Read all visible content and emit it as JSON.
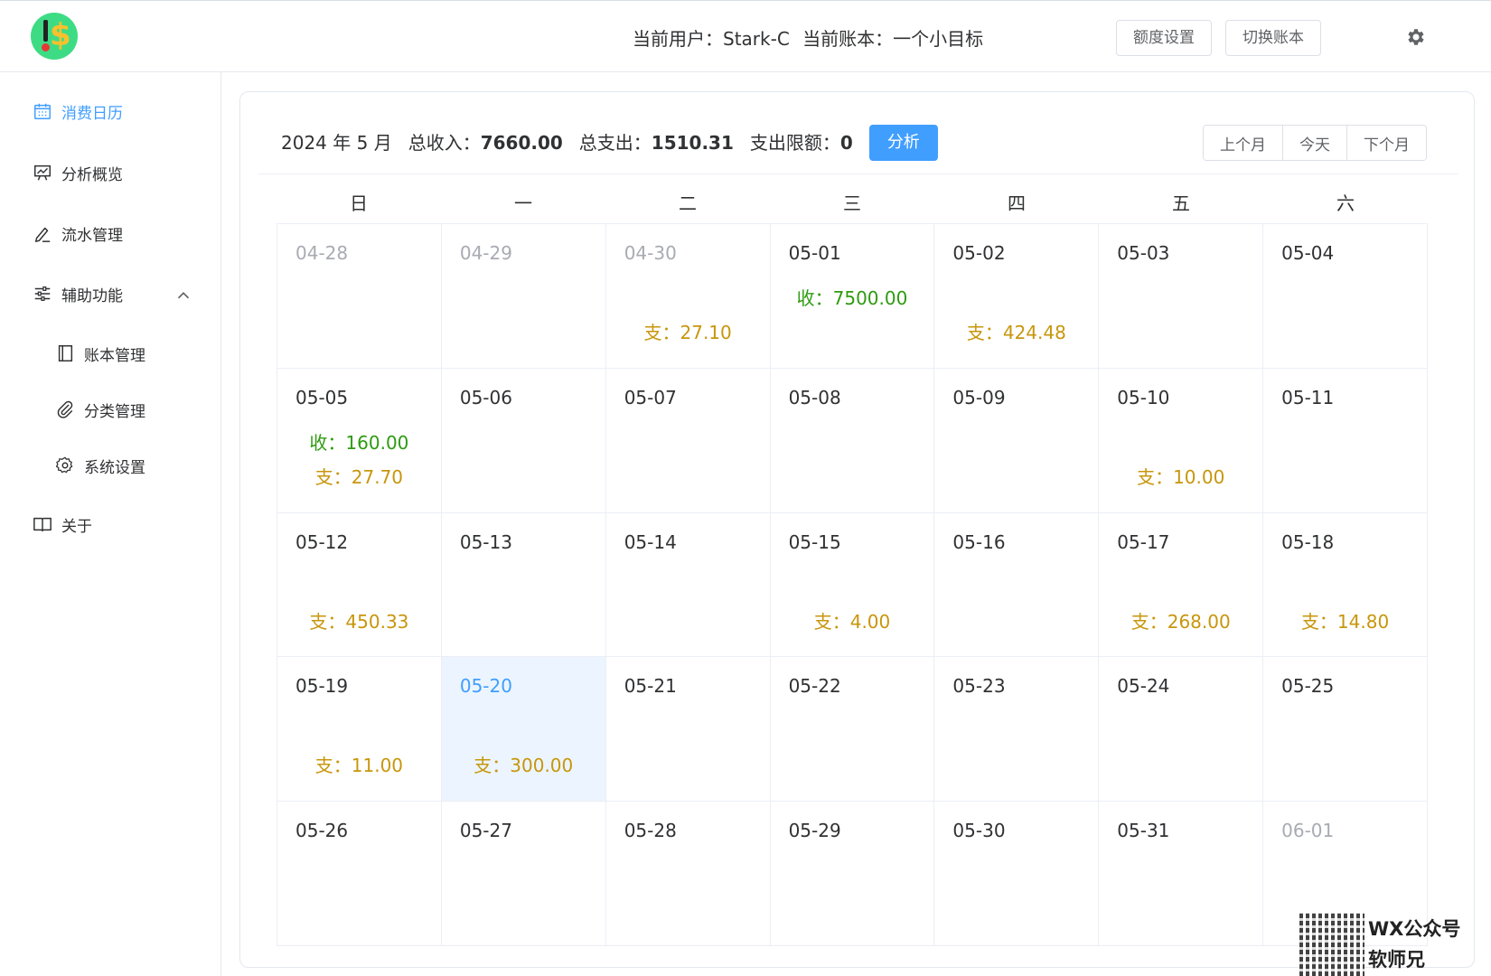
{
  "header": {
    "user_label": "当前用户：",
    "user_name": "Stark-C",
    "book_label": "当前账本：",
    "book_name": "一个小目标",
    "quota_button": "额度设置",
    "switch_button": "切换账本"
  },
  "sidebar": {
    "items": [
      {
        "label": "消费日历",
        "icon": "calendar-icon",
        "active": true
      },
      {
        "label": "分析概览",
        "icon": "presentation-icon"
      },
      {
        "label": "流水管理",
        "icon": "pencil-icon"
      },
      {
        "label": "辅助功能",
        "icon": "sliders-icon"
      },
      {
        "label": "账本管理",
        "icon": "notebook-icon"
      },
      {
        "label": "分类管理",
        "icon": "paperclip-icon"
      },
      {
        "label": "系统设置",
        "icon": "gear-icon"
      },
      {
        "label": "关于",
        "icon": "book-icon"
      }
    ]
  },
  "summary": {
    "period": "2024 年 5 月",
    "income_label": "总收入：",
    "income_value": "7660.00",
    "expense_label": "总支出：",
    "expense_value": "1510.31",
    "limit_label": "支出限额：",
    "limit_value": "0",
    "analyze_button": "分析"
  },
  "nav": {
    "prev": "上个月",
    "today": "今天",
    "next": "下个月"
  },
  "weekdays": [
    "日",
    "一",
    "二",
    "三",
    "四",
    "五",
    "六"
  ],
  "colors": {
    "accent": "#409eff",
    "income": "#2e9b10",
    "expense": "#c8960c"
  },
  "days": [
    {
      "date": "04-28",
      "other": true
    },
    {
      "date": "04-29",
      "other": true
    },
    {
      "date": "04-30",
      "other": true,
      "exp": "支：27.10"
    },
    {
      "date": "05-01",
      "inc": "收：7500.00"
    },
    {
      "date": "05-02",
      "exp": "支：424.48"
    },
    {
      "date": "05-03"
    },
    {
      "date": "05-04"
    },
    {
      "date": "05-05",
      "inc": "收：160.00",
      "exp": "支：27.70"
    },
    {
      "date": "05-06"
    },
    {
      "date": "05-07"
    },
    {
      "date": "05-08"
    },
    {
      "date": "05-09"
    },
    {
      "date": "05-10",
      "exp": "支：10.00"
    },
    {
      "date": "05-11"
    },
    {
      "date": "05-12",
      "exp": "支：450.33"
    },
    {
      "date": "05-13"
    },
    {
      "date": "05-14"
    },
    {
      "date": "05-15",
      "exp": "支：4.00"
    },
    {
      "date": "05-16"
    },
    {
      "date": "05-17",
      "exp": "支：268.00"
    },
    {
      "date": "05-18",
      "exp": "支：14.80"
    },
    {
      "date": "05-19",
      "exp": "支：11.00"
    },
    {
      "date": "05-20",
      "today": true,
      "exp": "支：300.00"
    },
    {
      "date": "05-21"
    },
    {
      "date": "05-22"
    },
    {
      "date": "05-23"
    },
    {
      "date": "05-24"
    },
    {
      "date": "05-25"
    },
    {
      "date": "05-26"
    },
    {
      "date": "05-27"
    },
    {
      "date": "05-28"
    },
    {
      "date": "05-29"
    },
    {
      "date": "05-30"
    },
    {
      "date": "05-31"
    },
    {
      "date": "06-01",
      "other": true
    }
  ],
  "watermark": {
    "line1": "WX公众号",
    "line2": "软师兄"
  }
}
